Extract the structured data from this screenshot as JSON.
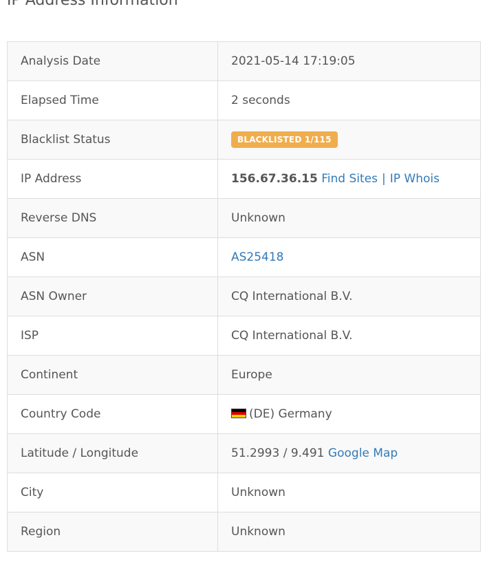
{
  "page": {
    "title": "IP Address Information"
  },
  "rows": {
    "analysis_date": {
      "label": "Analysis Date",
      "value": "2021-05-14 17:19:05"
    },
    "elapsed_time": {
      "label": "Elapsed Time",
      "value": "2 seconds"
    },
    "blacklist_status": {
      "label": "Blacklist Status",
      "badge": "BLACKLISTED 1/115",
      "badge_color": "#f0ad4e"
    },
    "ip_address": {
      "label": "IP Address",
      "ip": "156.67.36.15",
      "find_sites": "Find Sites",
      "separator": "|",
      "ip_whois": "IP Whois"
    },
    "reverse_dns": {
      "label": "Reverse DNS",
      "value": "Unknown"
    },
    "asn": {
      "label": "ASN",
      "link": "AS25418"
    },
    "asn_owner": {
      "label": "ASN Owner",
      "value": "CQ International B.V."
    },
    "isp": {
      "label": "ISP",
      "value": "CQ International B.V."
    },
    "continent": {
      "label": "Continent",
      "value": "Europe"
    },
    "country_code": {
      "label": "Country Code",
      "flag": "de-flag-icon",
      "value": "(DE) Germany"
    },
    "lat_long": {
      "label": "Latitude / Longitude",
      "value": "51.2993 / 9.491",
      "map_link": "Google Map"
    },
    "city": {
      "label": "City",
      "value": "Unknown"
    },
    "region": {
      "label": "Region",
      "value": "Unknown"
    }
  },
  "colors": {
    "link": "#337ab7",
    "text": "#555555",
    "border": "#dddddd",
    "stripe": "#f9f9f9"
  }
}
